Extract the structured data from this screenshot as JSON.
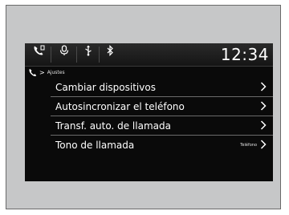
{
  "status_bar": {
    "icons": [
      {
        "name": "phone-settings-icon",
        "sublabel": ""
      },
      {
        "name": "microphone-icon",
        "sublabel": ""
      },
      {
        "name": "usb-icon",
        "sublabel": ""
      },
      {
        "name": "bluetooth-icon",
        "sublabel": ""
      }
    ],
    "clock_tag": "",
    "clock": "12:34"
  },
  "breadcrumb": {
    "icon": "phone-icon",
    "separator": ">",
    "label": "Ajustes"
  },
  "menu": {
    "items": [
      {
        "label": "Cambiar dispositivos",
        "value": ""
      },
      {
        "label": "Autosincronizar el teléfono",
        "value": ""
      },
      {
        "label": "Transf. auto. de llamada",
        "value": ""
      },
      {
        "label": "Tono de llamada",
        "value": "Teléfono"
      }
    ]
  },
  "colors": {
    "screen_bg": "#0a0a0a",
    "frame_bg": "#c6c7c8",
    "text": "#ffffff",
    "divider": "#6b6b6b"
  }
}
